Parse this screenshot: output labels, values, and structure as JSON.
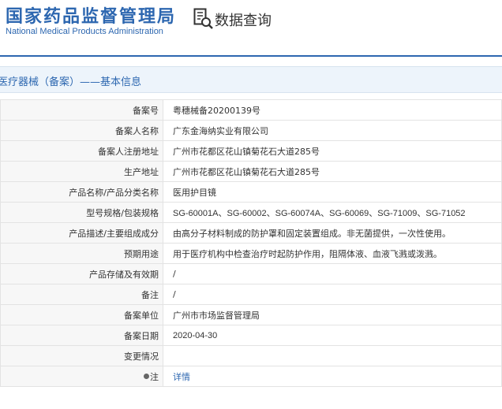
{
  "header": {
    "logo_cn": "国家药品监督管理局",
    "logo_en": "National Medical Products Administration",
    "query_title": "数据查询"
  },
  "section": {
    "title": "医疗器械（备案）——基本信息"
  },
  "rows": [
    {
      "label": "备案号",
      "value": "粤穗械备20200139号"
    },
    {
      "label": "备案人名称",
      "value": "广东金海纳实业有限公司"
    },
    {
      "label": "备案人注册地址",
      "value": "广州市花都区花山镇菊花石大道285号"
    },
    {
      "label": "生产地址",
      "value": "广州市花都区花山镇菊花石大道285号"
    },
    {
      "label": "产品名称/产品分类名称",
      "value": "医用护目镜"
    },
    {
      "label": "型号规格/包装规格",
      "value": "SG-60001A、SG-60002、SG-60074A、SG-60069、SG-71009、SG-71052"
    },
    {
      "label": "产品描述/主要组成成分",
      "value": "由高分子材料制成的防护罩和固定装置组成。非无菌提供，一次性使用。"
    },
    {
      "label": "预期用途",
      "value": "用于医疗机构中检查治疗时起防护作用，阻隔体液、血液飞溅或泼溅。"
    },
    {
      "label": "产品存储及有效期",
      "value": "/"
    },
    {
      "label": "备注",
      "value": "/"
    },
    {
      "label": "备案单位",
      "value": "广州市市场监督管理局"
    },
    {
      "label": "备案日期",
      "value": "2020-04-30"
    },
    {
      "label": "变更情况",
      "value": ""
    },
    {
      "label": "注",
      "value": "详情"
    }
  ],
  "colors": {
    "brand": "#2d67b0",
    "section_bg": "#edf4fb",
    "label_bg": "#f7f7f7",
    "border": "#e3e3e3"
  },
  "icons": {
    "query": "document-search-icon",
    "note": "dot-icon"
  }
}
